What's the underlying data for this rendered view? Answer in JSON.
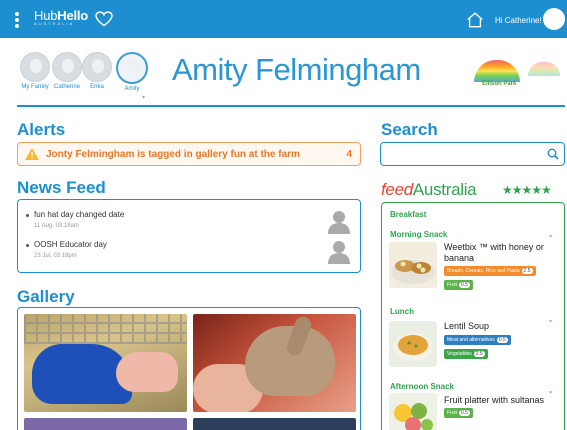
{
  "topbar": {
    "logo_main": "Hub",
    "logo_bold": "Hello",
    "logo_sub": "AUSTRALIA",
    "greeting": "Hi Catherine!",
    "icons": [
      "menu-icon",
      "heart-icon",
      "home-icon"
    ]
  },
  "profiles": [
    {
      "name": "My Family"
    },
    {
      "name": "Catherine"
    },
    {
      "name": "Erika"
    },
    {
      "name": "Amity"
    }
  ],
  "child_name": "Amity Felmingham",
  "centre": {
    "name": "Ellison Park"
  },
  "alerts": {
    "title": "Alerts",
    "message": "Jonty Felmingham is tagged in gallery fun at the farm",
    "count": "4"
  },
  "news_feed": {
    "title": "News Feed",
    "items": [
      {
        "title": "fun hat day changed date",
        "time": "11 Aug, 03:18am"
      },
      {
        "title": "OOSH Educator day",
        "time": "23 Jul, 03:18pm"
      }
    ]
  },
  "gallery": {
    "title": "Gallery"
  },
  "search": {
    "title": "Search",
    "placeholder": ""
  },
  "feed": {
    "brand_feed": "feed",
    "brand_australia": "Australia",
    "stars": "★★★★★",
    "meals": [
      {
        "title": "Breakfast"
      },
      {
        "title": "Morning Snack",
        "food": "Weetbix ™ with honey or banana",
        "tags": [
          {
            "label": "Breads, Cereals, Rice and Pasta",
            "serve": "2.5"
          },
          {
            "label": "Fruit",
            "serve": "0.5"
          }
        ]
      },
      {
        "title": "Lunch",
        "food": "Lentil Soup",
        "tags": [
          {
            "label": "Meat and alternatives",
            "serve": "0.5"
          },
          {
            "label": "Vegetables",
            "serve": "2.5"
          }
        ]
      },
      {
        "title": "Afternoon Snack",
        "food": "Fruit platter with sultanas",
        "tags": [
          {
            "label": "Fruit",
            "serve": "0.5"
          }
        ]
      }
    ]
  },
  "colors": {
    "primary": "#1d8fd1",
    "alert": "#e8782a",
    "feed_green": "#2ea44f",
    "feed_red": "#e8412e"
  }
}
